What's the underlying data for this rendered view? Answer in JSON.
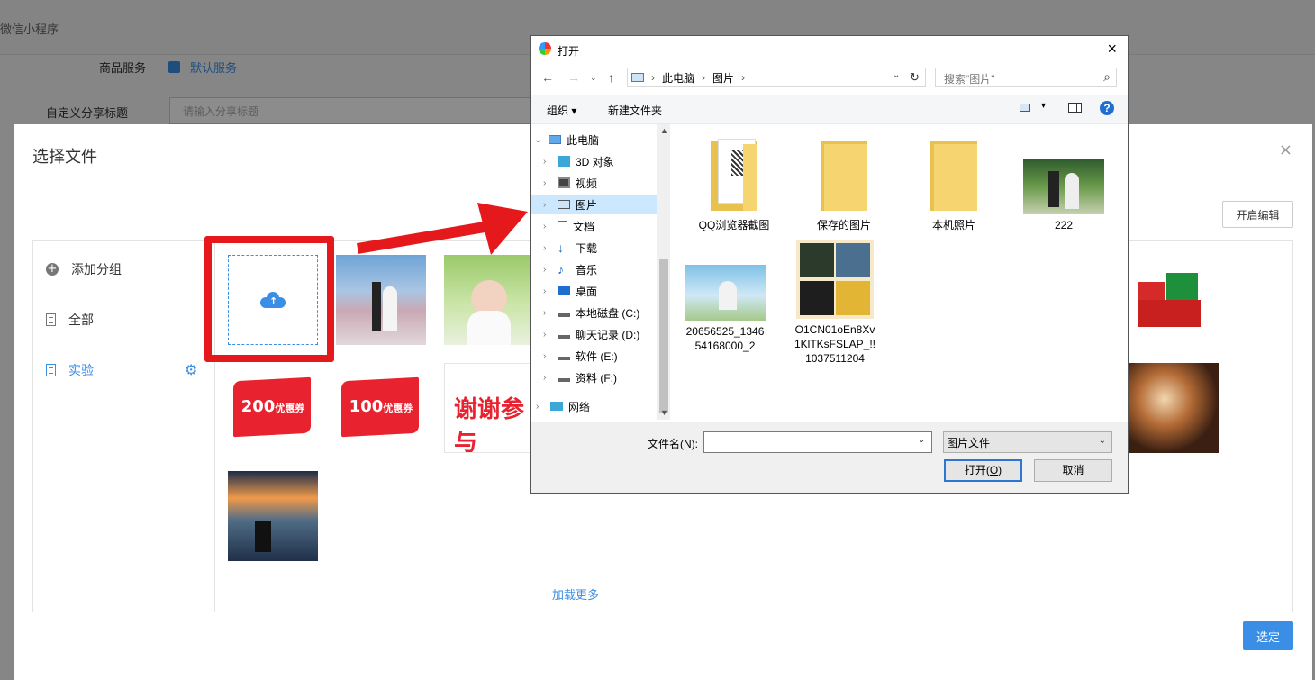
{
  "background": {
    "app_name": "微信小程序",
    "service_label": "商品服务",
    "service_value": "默认服务",
    "share_title_label": "自定义分享标题",
    "share_title_placeholder": "请输入分享标题"
  },
  "modal": {
    "title": "选择文件",
    "close": "×",
    "edit_button": "开启编辑",
    "sidebar": {
      "add_group": "添加分组",
      "all": "全部",
      "experiment": "实验"
    },
    "coupon_200": "200",
    "coupon_100": "100",
    "coupon_suffix": "优惠券",
    "thanks_text": "谢谢参与",
    "load_more": "加载更多",
    "confirm_button": "选定"
  },
  "dialog": {
    "title": "打开",
    "close": "×",
    "breadcrumb": [
      "此电脑",
      "图片"
    ],
    "search_placeholder": "搜索\"图片\"",
    "toolbar": {
      "organize": "组织 ▾",
      "new_folder": "新建文件夹"
    },
    "tree": [
      {
        "label": "此电脑",
        "icon": "pc-icon"
      },
      {
        "label": "3D 对象",
        "icon": "3d-objects-icon"
      },
      {
        "label": "视频",
        "icon": "video-icon"
      },
      {
        "label": "图片",
        "icon": "pictures-icon"
      },
      {
        "label": "文档",
        "icon": "documents-icon"
      },
      {
        "label": "下载",
        "icon": "downloads-icon"
      },
      {
        "label": "音乐",
        "icon": "music-icon"
      },
      {
        "label": "桌面",
        "icon": "desktop-icon"
      },
      {
        "label": "本地磁盘 (C:)",
        "icon": "drive-icon"
      },
      {
        "label": "聊天记录 (D:)",
        "icon": "drive-icon"
      },
      {
        "label": "软件 (E:)",
        "icon": "drive-icon"
      },
      {
        "label": "资料 (F:)",
        "icon": "drive-icon"
      },
      {
        "label": "网络",
        "icon": "network-icon"
      }
    ],
    "files": [
      {
        "name": "QQ浏览器截图",
        "type": "folder"
      },
      {
        "name": "保存的图片",
        "type": "folder"
      },
      {
        "name": "本机照片",
        "type": "folder"
      },
      {
        "name": "222",
        "type": "image"
      },
      {
        "name": "20656525_1346\n54168000_2",
        "type": "image"
      },
      {
        "name": "O1CN01oEn8Xv\n1KlTKsFSLAP_!!\n1037511204",
        "type": "image"
      }
    ],
    "filename_label_prefix": "文件名(",
    "filename_label_key": "N",
    "filename_label_suffix": "):",
    "filetype": "图片文件",
    "open_prefix": "打开(",
    "open_key": "O",
    "open_suffix": ")",
    "cancel": "取消"
  },
  "colors": {
    "accent": "#3a8ee6",
    "annotation_red": "#e5191b",
    "coupon_red": "#e8232f"
  }
}
